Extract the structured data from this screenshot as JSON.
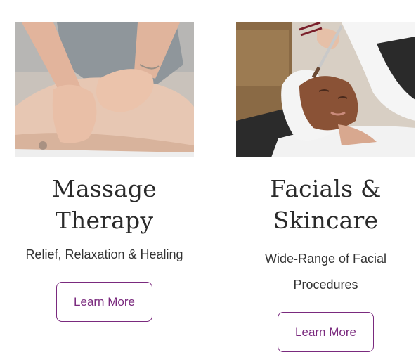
{
  "cards": [
    {
      "title_line1": "Massage",
      "title_line2": "Therapy",
      "subtitle": "Relief, Relaxation & Healing",
      "button_label": "Learn More"
    },
    {
      "title_line1": "Facials &",
      "title_line2": "Skincare",
      "subtitle": "Wide-Range of Facial Procedures",
      "button_label": "Learn More"
    }
  ],
  "colors": {
    "accent": "#7a2a7e",
    "heading": "#2a2a2a",
    "body_text": "#333333"
  }
}
